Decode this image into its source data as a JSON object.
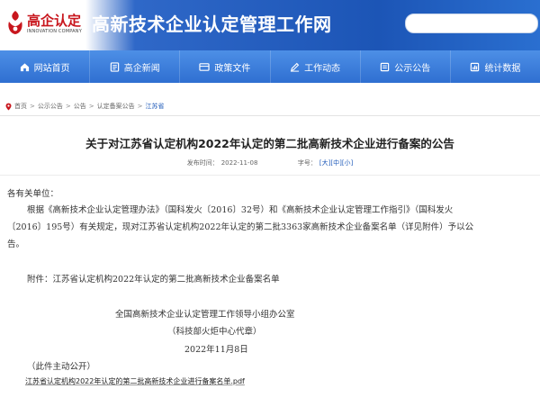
{
  "logo": {
    "name": "高企认定",
    "subtitle": "INNOVATION COMPANY",
    "brand_color": "#c8161d"
  },
  "site_title": "高新技术企业认定管理工作网",
  "nav": {
    "items": [
      {
        "label": "网站首页",
        "icon": "home-icon"
      },
      {
        "label": "高企新闻",
        "icon": "news-icon"
      },
      {
        "label": "政策文件",
        "icon": "policy-doc-icon"
      },
      {
        "label": "工作动态",
        "icon": "work-edit-icon"
      },
      {
        "label": "公示公告",
        "icon": "notice-icon"
      },
      {
        "label": "统计数据",
        "icon": "chart-icon"
      }
    ],
    "bg_color": "#3a7ad8"
  },
  "breadcrumb": {
    "items": [
      "首页",
      "公示公告",
      "公告",
      "认定备案公告",
      "江苏省"
    ],
    "separator": ">"
  },
  "article": {
    "title": "关于对江苏省认定机构2022年认定的第二批高新技术企业进行备案的公告",
    "meta": {
      "date_label": "发布时间：",
      "date": "2022-11-08",
      "size_label": "字号：",
      "sizes": [
        "[大]",
        "[中]",
        "[小]"
      ]
    },
    "greeting": "各有关单位：",
    "para_line1": "根据《高新技术企业认定管理办法》（国科发火〔2016〕32号）和《高新技术企业认定管理工作指引》（国科发火",
    "para_line2": "〔2016〕195号）有关规定，现对江苏省认定机构2022年认定的第二批3363家高新技术企业备案名单（详见附件）予以公",
    "para_line3": "告。",
    "attachment_line": "附件：江苏省认定机构2022年认定的第二批高新技术企业备案名单",
    "sign_org": "全国高新技术企业认定管理工作领导小组办公室",
    "sign_sub": "（科技部火炬中心代章）",
    "sign_date": "2022年11月8日",
    "disclosure": "（此件主动公开）",
    "pdf_link": "江苏省认定机构2022年认定的第二批高新技术企业进行备案名单.pdf"
  }
}
